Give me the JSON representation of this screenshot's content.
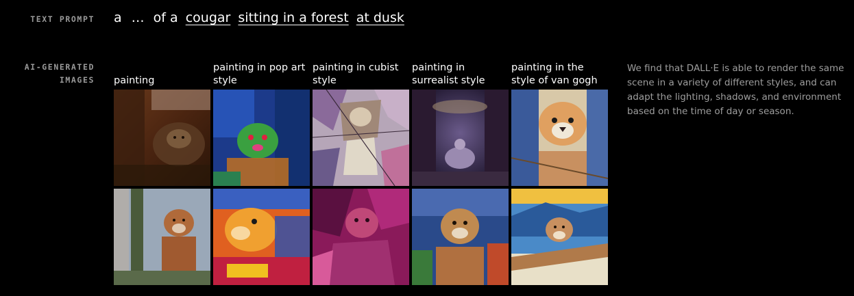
{
  "labels": {
    "text_prompt": "TEXT PROMPT",
    "ai_generated_images": "AI-GENERATED IMAGES"
  },
  "prompt": {
    "a": "a",
    "ellipsis": "…",
    "of_a": "of a",
    "subject": "cougar",
    "setting": "sitting in a forest",
    "time": "at dusk"
  },
  "styles": [
    {
      "label": "painting"
    },
    {
      "label": "painting in pop art style"
    },
    {
      "label": "painting in cubist style"
    },
    {
      "label": "painting in surrealist style"
    },
    {
      "label": "painting in the style of van gogh"
    }
  ],
  "description": "We find that DALL·E is able to render the same scene in a variety of different styles, and can adapt the lighting, shadows, and environment based on the time of day or season.",
  "colors": {
    "background": "#000000",
    "label_gray": "#9a9a9a",
    "description_gray": "#9e9e9e",
    "text_white": "#ffffff"
  }
}
